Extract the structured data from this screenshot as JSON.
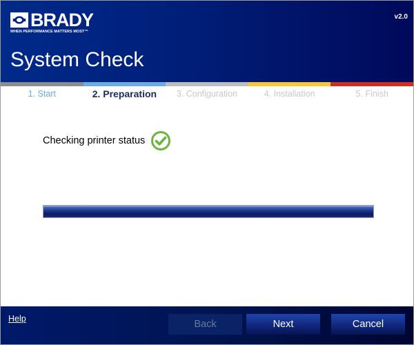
{
  "header": {
    "brand": "BRADY",
    "tagline": "WHEN PERFORMANCE MATTERS MOST™",
    "version": "v2.0",
    "title": "System Check"
  },
  "steps": [
    {
      "label": "1. Start",
      "state": "done",
      "color": "#8c8c8c"
    },
    {
      "label": "2. Preparation",
      "state": "active",
      "color": "#6aade4"
    },
    {
      "label": "3. Configuration",
      "state": "pending",
      "color": "#bdbdbd"
    },
    {
      "label": "4. Installation",
      "state": "pending",
      "color": "#fdc82f"
    },
    {
      "label": "5. Finish",
      "state": "pending",
      "color": "#d52b1e"
    }
  ],
  "main": {
    "status_text": "Checking printer status",
    "status_icon": "check-circle-icon",
    "status_color": "#6cb33f",
    "progress_percent": 100
  },
  "footer": {
    "help_label": "Help",
    "back_label": "Back",
    "next_label": "Next",
    "cancel_label": "Cancel",
    "back_enabled": false
  }
}
